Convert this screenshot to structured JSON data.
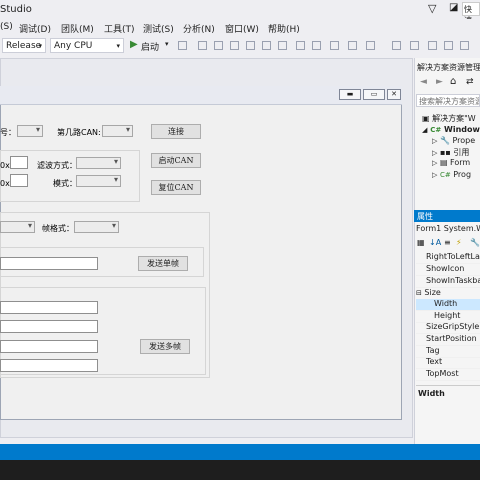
{
  "window": {
    "title": "Studio",
    "quick_launch": "快速"
  },
  "menu": [
    {
      "label": "(S)"
    },
    {
      "label": "调试(D)"
    },
    {
      "label": "团队(M)"
    },
    {
      "label": "工具(T)"
    },
    {
      "label": "测试(S)"
    },
    {
      "label": "分析(N)"
    },
    {
      "label": "窗口(W)"
    },
    {
      "label": "帮助(H)"
    }
  ],
  "toolbar": {
    "config": "Release",
    "platform": "Any CPU",
    "start_label": "启动"
  },
  "form": {
    "labels": {
      "port_suffix": "号：",
      "can_channel": "第几路CAN:",
      "filter_mode": "滤波方式：",
      "mode": "模式：",
      "hex_prefix_1": "0x",
      "hex_prefix_2": "0x",
      "frame_format": "帧格式："
    },
    "buttons": {
      "connect": "连接",
      "start_can": "启动CAN",
      "reset_can": "复位CAN",
      "send_single": "发送单帧",
      "send_multi": "发送多帧"
    }
  },
  "solution_explorer": {
    "title": "解决方案资源管理",
    "search_placeholder": "搜索解决方案资源",
    "items": [
      {
        "label": "解决方案\"W"
      },
      {
        "label": "Window"
      },
      {
        "label": "Prope"
      },
      {
        "label": "引用"
      },
      {
        "label": "Form"
      },
      {
        "label": "Prog"
      }
    ]
  },
  "properties": {
    "title": "属性",
    "object": "Form1 System.W",
    "rows": [
      {
        "name": "RightToLeftLay"
      },
      {
        "name": "ShowIcon"
      },
      {
        "name": "ShowInTaskba"
      },
      {
        "name": "Size"
      },
      {
        "name": "Width"
      },
      {
        "name": "Height"
      },
      {
        "name": "SizeGripStyle"
      },
      {
        "name": "StartPosition"
      },
      {
        "name": "Tag"
      },
      {
        "name": "Text"
      },
      {
        "name": "TopMost"
      }
    ],
    "description_title": "Width"
  },
  "colors": {
    "accent": "#007acc",
    "selected": "#cce8ff",
    "panel_header": "#007acc"
  }
}
